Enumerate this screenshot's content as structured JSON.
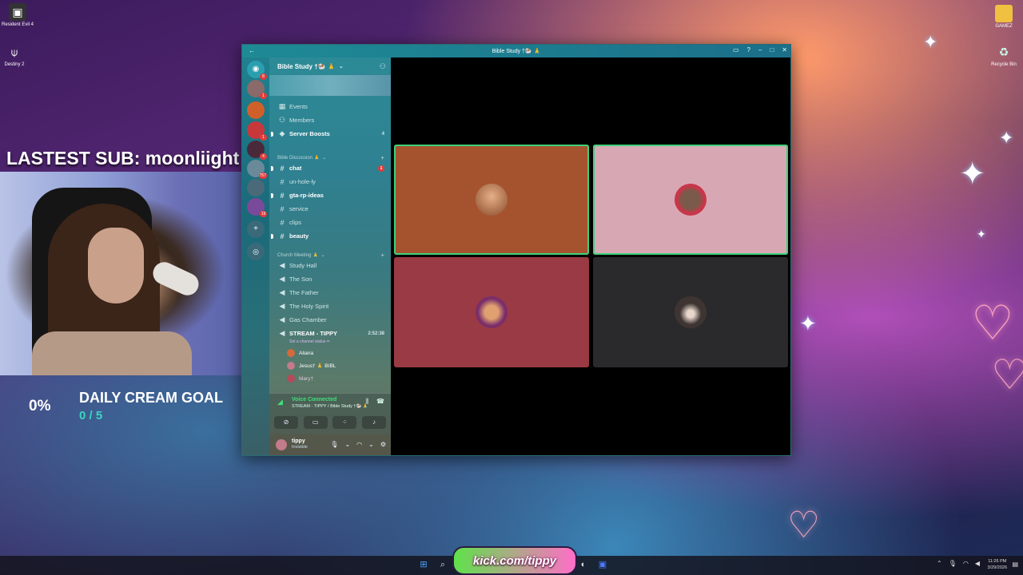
{
  "desktop": {
    "icons_left": [
      {
        "label": "Resident Evil 4",
        "icon": "resident-evil-icon"
      },
      {
        "label": "Destiny 2",
        "icon": "destiny-icon"
      }
    ],
    "icons_right": [
      {
        "label": "GAMEZ",
        "icon": "folder-icon"
      },
      {
        "label": "Recycle Bin",
        "icon": "recycle-bin-icon"
      }
    ]
  },
  "stream_overlay": {
    "latest_sub": "LASTEST SUB: moonliight",
    "goal_percent": "0%",
    "goal_title": "DAILY CREAM GOAL",
    "goal_count": "0 / 5"
  },
  "window": {
    "title": "Bible Study †🐏 🙏",
    "server_name": "Bible Study †🐏 🙏"
  },
  "server_rail": {
    "badges": [
      "8",
      "1",
      "",
      "1",
      "4",
      "757",
      "",
      "19",
      "",
      ""
    ]
  },
  "channels": {
    "top_items": [
      {
        "label": "Events",
        "icon": "calendar-icon"
      },
      {
        "label": "Members",
        "icon": "members-icon"
      },
      {
        "label": "Server Boosts",
        "icon": "boost-icon",
        "right": "4"
      }
    ],
    "category_1": "Bible Discussion 🙏",
    "text_channels": [
      {
        "label": "chat",
        "bright": true,
        "badge": "1"
      },
      {
        "label": "un-hole-ly",
        "bright": false
      },
      {
        "label": "gta-rp-ideas",
        "bright": true
      },
      {
        "label": "service",
        "bright": false
      },
      {
        "label": "clips",
        "bright": false
      },
      {
        "label": "beauty",
        "bright": true
      }
    ],
    "category_2": "Church Meeting 🙏",
    "voice_channels": [
      {
        "label": "Study Hall"
      },
      {
        "label": "The Son"
      },
      {
        "label": "The Father"
      },
      {
        "label": "The Holy Spirit"
      },
      {
        "label": "Gas Chamber"
      }
    ],
    "active_voice": {
      "label": "STREAM - TIPPY",
      "time": "2:52:38",
      "status": "Set a channel status ✏"
    },
    "voice_users": [
      {
        "name": "Aliana",
        "color": "#d46a3a"
      },
      {
        "name": "Jesus† 🙏 BIBL",
        "color": "#c27b8a"
      },
      {
        "name": "Mary†",
        "color": "#b44a5a"
      }
    ]
  },
  "voice_panel": {
    "title": "Voice Connected",
    "subtitle": "STREAM - TIPPY / Bible Study †🐏 🙏"
  },
  "user_panel": {
    "name": "tippy",
    "status": "Invisible"
  },
  "video_tiles": [
    {
      "color": "#a5532f",
      "avatar_color": "#c98a5a",
      "speaking": true
    },
    {
      "color": "#d7a8b4",
      "avatar_color": "#c9364a",
      "speaking": true
    },
    {
      "color": "#9a3a44",
      "avatar_color": "#7a2e6a",
      "speaking": false
    },
    {
      "color": "#2a2a2d",
      "avatar_color": "#3e3533",
      "speaking": false
    }
  ],
  "taskbar": {
    "kick_text": "kick.com/tippy",
    "clock_time": "11:26 PM",
    "clock_date": "3/29/2026"
  }
}
